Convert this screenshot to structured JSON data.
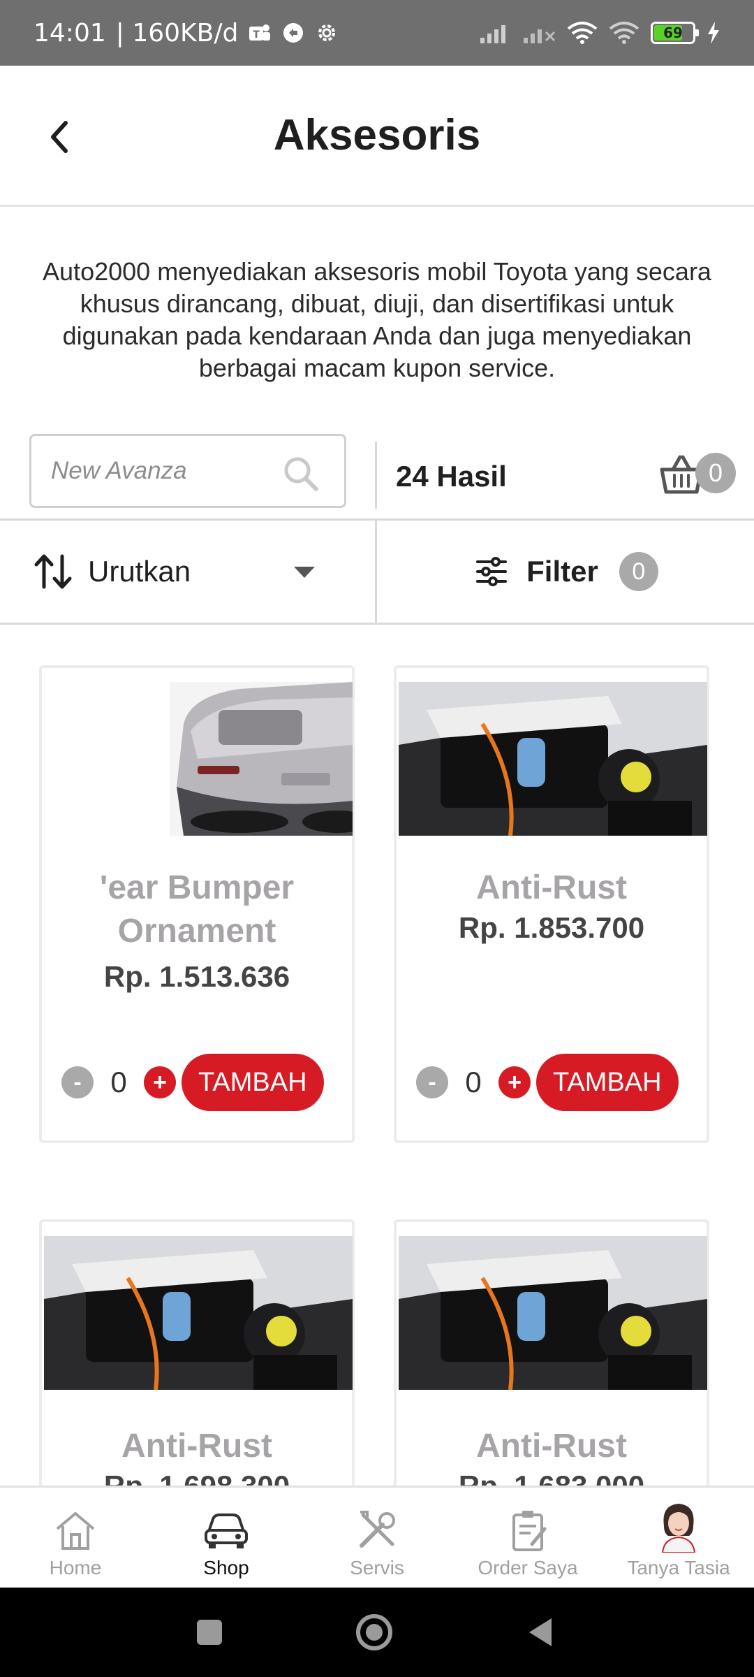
{
  "status_bar": {
    "time": "14:01",
    "data_speed": "| 160KB/d",
    "battery": "69"
  },
  "header": {
    "title": "Aksesoris"
  },
  "description": "Auto2000 menyediakan aksesoris mobil Toyota yang secara khusus dirancang, dibuat, diuji, dan disertifikasi untuk digunakan pada kendaraan Anda dan juga menyediakan berbagai macam kupon service.",
  "search": {
    "placeholder": "New Avanza"
  },
  "results": {
    "count_label": "24 Hasil",
    "cart_count": "0"
  },
  "sort": {
    "label": "Urutkan"
  },
  "filter": {
    "label": "Filter",
    "count": "0"
  },
  "products": [
    {
      "name_line1": "'ear Bumper",
      "name_line2": "Ornament",
      "price": "Rp. 1.513.636",
      "qty": "0",
      "add_label": "TAMBAH",
      "minus": "-",
      "plus": "+"
    },
    {
      "name_line1": "Anti-Rust",
      "name_line2": "",
      "price": "Rp. 1.853.700",
      "qty": "0",
      "add_label": "TAMBAH",
      "minus": "-",
      "plus": "+"
    },
    {
      "name_line1": "Anti-Rust",
      "name_line2": "",
      "price": "Rp. 1.698.300"
    },
    {
      "name_line1": "Anti-Rust",
      "name_line2": "",
      "price": "Rp. 1.683.000"
    }
  ],
  "bottom_nav": [
    {
      "label": "Home",
      "icon": "home-icon",
      "active": false
    },
    {
      "label": "Shop",
      "icon": "car-icon",
      "active": true
    },
    {
      "label": "Servis",
      "icon": "tools-icon",
      "active": false
    },
    {
      "label": "Order Saya",
      "icon": "clipboard-icon",
      "active": false
    },
    {
      "label": "Tanya Tasia",
      "icon": "avatar-icon",
      "active": false
    }
  ],
  "colors": {
    "accent_red": "#d71b24",
    "badge_gray": "#a9a9a9",
    "product_name_gray": "#a7a4a8",
    "status_bar": "#6f6f6f"
  }
}
